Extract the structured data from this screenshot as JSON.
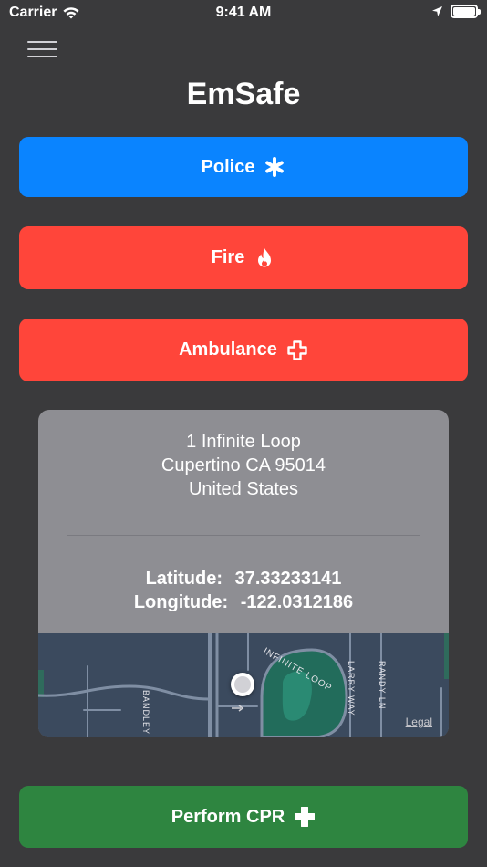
{
  "status_bar": {
    "carrier": "Carrier",
    "time": "9:41 AM"
  },
  "app": {
    "title": "EmSafe"
  },
  "buttons": {
    "police": "Police",
    "fire": "Fire",
    "ambulance": "Ambulance",
    "cpr": "Perform CPR"
  },
  "location": {
    "address_line1": "1 Infinite Loop",
    "address_line2": "Cupertino CA 95014",
    "address_line3": "United States",
    "latitude_label": "Latitude:",
    "latitude_value": "37.33233141",
    "longitude_label": "Longitude:",
    "longitude_value": "-122.0312186"
  },
  "map": {
    "street_labels": [
      "INFINITE LOOP",
      "LARRY WAY",
      "RANDY LN",
      "BANDLEY"
    ],
    "legal": "Legal"
  },
  "colors": {
    "background": "#3a3a3c",
    "police": "#0a84ff",
    "fire": "#ff453a",
    "ambulance": "#ff453a",
    "cpr": "#2e8540",
    "card": "#8e8e93"
  }
}
